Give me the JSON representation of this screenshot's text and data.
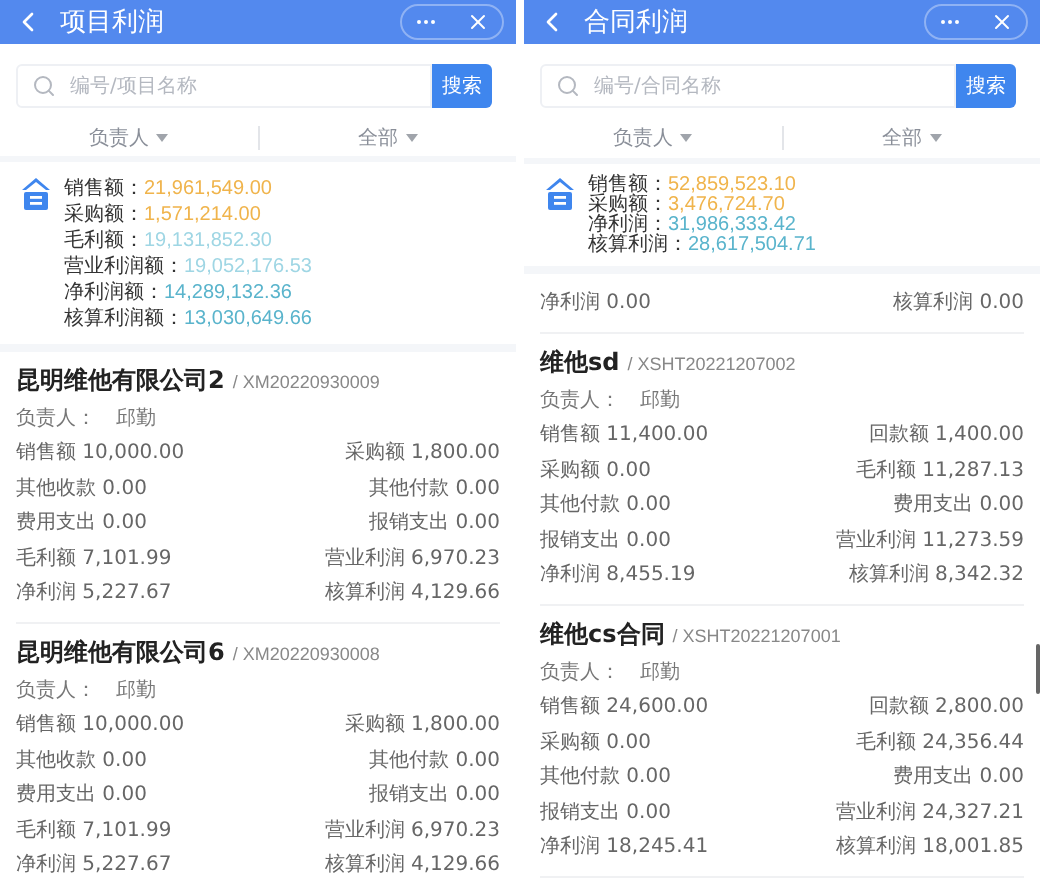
{
  "panels": [
    {
      "title": "项目利润",
      "search": {
        "placeholder": "编号/项目名称",
        "button": "搜索"
      },
      "filters": [
        "负责人",
        "全部"
      ],
      "summary": [
        {
          "label": "销售额：",
          "value": "21,961,549.00",
          "color": "#f0b44c"
        },
        {
          "label": "采购额：",
          "value": "1,571,214.00",
          "color": "#f0b44c"
        },
        {
          "label": "毛利额：",
          "value": "19,131,852.30",
          "color": "#9fd6e4"
        },
        {
          "label": "营业利润额：",
          "value": "19,052,176.53",
          "color": "#9fd6e4"
        },
        {
          "label": "净利润额：",
          "value": "14,289,132.36",
          "color": "#5ab4cc"
        },
        {
          "label": "核算利润额：",
          "value": "13,030,649.66",
          "color": "#5ab4cc"
        }
      ],
      "cards": [
        {
          "name": "昆明维他有限公司2",
          "code": "/ XM20220930009",
          "owner_label": "负责人：",
          "owner": "邱勤",
          "fields": [
            [
              "销售额 10,000.00",
              "采购额 1,800.00"
            ],
            [
              "其他收款 0.00",
              "其他付款 0.00"
            ],
            [
              "费用支出 0.00",
              "报销支出 0.00"
            ],
            [
              "毛利额 7,101.99",
              "营业利润 6,970.23"
            ],
            [
              "净利润 5,227.67",
              "核算利润 4,129.66"
            ]
          ]
        },
        {
          "name": "昆明维他有限公司6",
          "code": "/ XM20220930008",
          "owner_label": "负责人：",
          "owner": "邱勤",
          "fields": [
            [
              "销售额 10,000.00",
              "采购额 1,800.00"
            ],
            [
              "其他收款 0.00",
              "其他付款 0.00"
            ],
            [
              "费用支出 0.00",
              "报销支出 0.00"
            ],
            [
              "毛利额 7,101.99",
              "营业利润 6,970.23"
            ],
            [
              "净利润 5,227.67",
              "核算利润 4,129.66"
            ]
          ]
        }
      ]
    },
    {
      "title": "合同利润",
      "search": {
        "placeholder": "编号/合同名称",
        "button": "搜索"
      },
      "filters": [
        "负责人",
        "全部"
      ],
      "scrollbar": true,
      "summary": [
        {
          "label": "销售额：",
          "value": "52,859,523.10",
          "color": "#f0b44c"
        },
        {
          "label": "采购额：",
          "value": "3,476,724.70",
          "color": "#f0b44c"
        },
        {
          "label": "净利润：",
          "value": "31,986,333.42",
          "color": "#5ab4cc"
        },
        {
          "label": "核算利润：",
          "value": "28,617,504.71",
          "color": "#5ab4cc"
        }
      ],
      "cards": [
        {
          "fields": [
            [
              "净利润 0.00",
              "核算利润 0.00"
            ]
          ]
        },
        {
          "name": "维他sd",
          "code": "/ XSHT20221207002",
          "owner_label": "负责人：",
          "owner": "邱勤",
          "fields": [
            [
              "销售额 11,400.00",
              "回款额 1,400.00"
            ],
            [
              "采购额 0.00",
              "毛利额 11,287.13"
            ],
            [
              "其他付款 0.00",
              "费用支出 0.00"
            ],
            [
              "报销支出 0.00",
              "营业利润 11,273.59"
            ],
            [
              "净利润 8,455.19",
              "核算利润 8,342.32"
            ]
          ]
        },
        {
          "name": "维他cs合同",
          "code": "/ XSHT20221207001",
          "owner_label": "负责人：",
          "owner": "邱勤",
          "fields": [
            [
              "销售额 24,600.00",
              "回款额 2,800.00"
            ],
            [
              "采购额 0.00",
              "毛利额 24,356.44"
            ],
            [
              "其他付款 0.00",
              "费用支出 0.00"
            ],
            [
              "报销支出 0.00",
              "营业利润 24,327.21"
            ],
            [
              "净利润 18,245.41",
              "核算利润 18,001.85"
            ]
          ]
        }
      ]
    }
  ]
}
